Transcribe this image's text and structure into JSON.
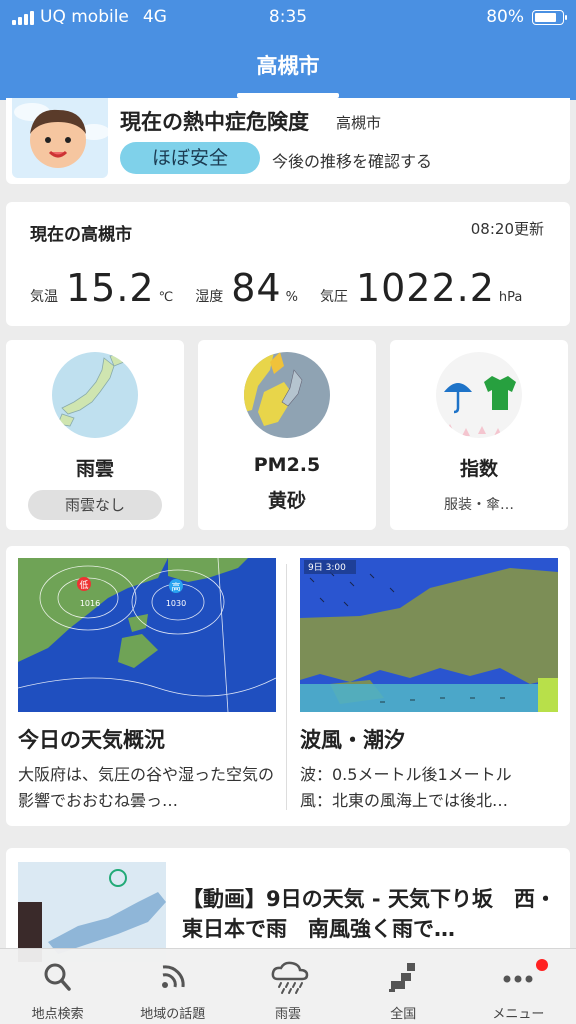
{
  "status_bar": {
    "carrier": "UQ mobile",
    "network": "4G",
    "time": "8:35",
    "battery": "80%",
    "battery_level": 0.8
  },
  "header": {
    "title": "高槻市"
  },
  "heatstroke": {
    "title": "現在の熱中症危険度",
    "location": "高槻市",
    "level": "ほぼ安全",
    "link": "今後の推移を確認する"
  },
  "current": {
    "title": "現在の高槻市",
    "updated": "08:20更新",
    "temp_label": "気温",
    "temp_value": "15.2",
    "temp_unit": "℃",
    "humidity_label": "湿度",
    "humidity_value": "84",
    "humidity_unit": "%",
    "pressure_label": "気圧",
    "pressure_value": "1022.2",
    "pressure_unit": "hPa"
  },
  "tiles": [
    {
      "label": "雨雲",
      "pill": "雨雲なし"
    },
    {
      "label": "PM2.5",
      "sub": "黄砂"
    },
    {
      "label": "指数",
      "sub": "服装・傘…"
    }
  ],
  "news": [
    {
      "title": "今日の天気概況",
      "body": "大阪府は、気圧の谷や湿った空気の影響でおおむね曇っ…",
      "map_labels": {
        "low": "低",
        "low_hpa": "1016",
        "high": "高",
        "high_hpa": "1030"
      }
    },
    {
      "title": "波風・潮汐",
      "body_line1": "波：0.5メートル後1メートル",
      "body_line2": "風：北東の風海上では後北…",
      "map_time": "9日 3:00"
    }
  ],
  "video": {
    "title": "【動画】9日の天気 - 天気下り坂　西・東日本で雨　南風強く雨で…"
  },
  "tabbar": [
    {
      "label": "地点検索",
      "icon": "search-icon"
    },
    {
      "label": "地域の話題",
      "icon": "rss-icon"
    },
    {
      "label": "雨雲",
      "icon": "rain-cloud-icon"
    },
    {
      "label": "全国",
      "icon": "japan-map-icon"
    },
    {
      "label": "メニュー",
      "icon": "more-icon"
    }
  ],
  "colors": {
    "header": "#4a90e2",
    "badge": "#7fd1ea",
    "notification": "#ff2222"
  }
}
